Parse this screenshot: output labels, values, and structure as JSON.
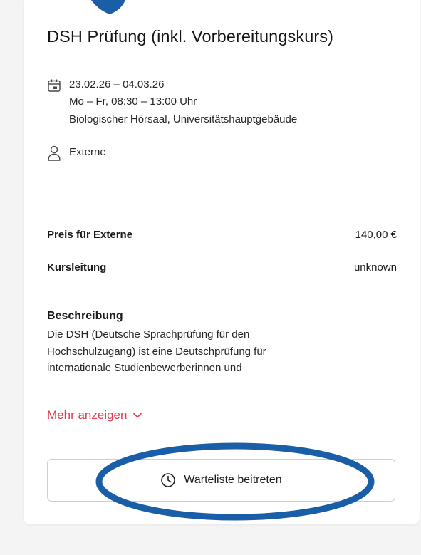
{
  "course": {
    "title": "DSH Prüfung (inkl. Vorbereitungskurs)",
    "dates": "23.02.26 – 04.03.26",
    "schedule": "Mo – Fr, 08:30 – 13:00 Uhr",
    "location": "Biologischer Hörsaal, Universitätshauptgebäude",
    "audience": "Externe"
  },
  "info": {
    "price_label": "Preis für Externe",
    "price_value": "140,00 €",
    "lead_label": "Kursleitung",
    "lead_value": "unknown"
  },
  "description": {
    "heading": "Beschreibung",
    "line1": "Die DSH (Deutsche Sprachprüfung für den",
    "line2": "Hochschulzugang) ist eine Deutschprüfung für",
    "line3": "internationale Studienbewerberinnen und",
    "more_label": "Mehr anzeigen"
  },
  "actions": {
    "waitlist_label": "Warteliste beitreten"
  },
  "icons": {
    "date": "calendar-icon",
    "audience": "user-icon",
    "more": "chevron-down-icon",
    "waitlist": "clock-icon"
  },
  "colors": {
    "accent_link": "#e63a4e",
    "annotation": "#1b5ea8"
  }
}
